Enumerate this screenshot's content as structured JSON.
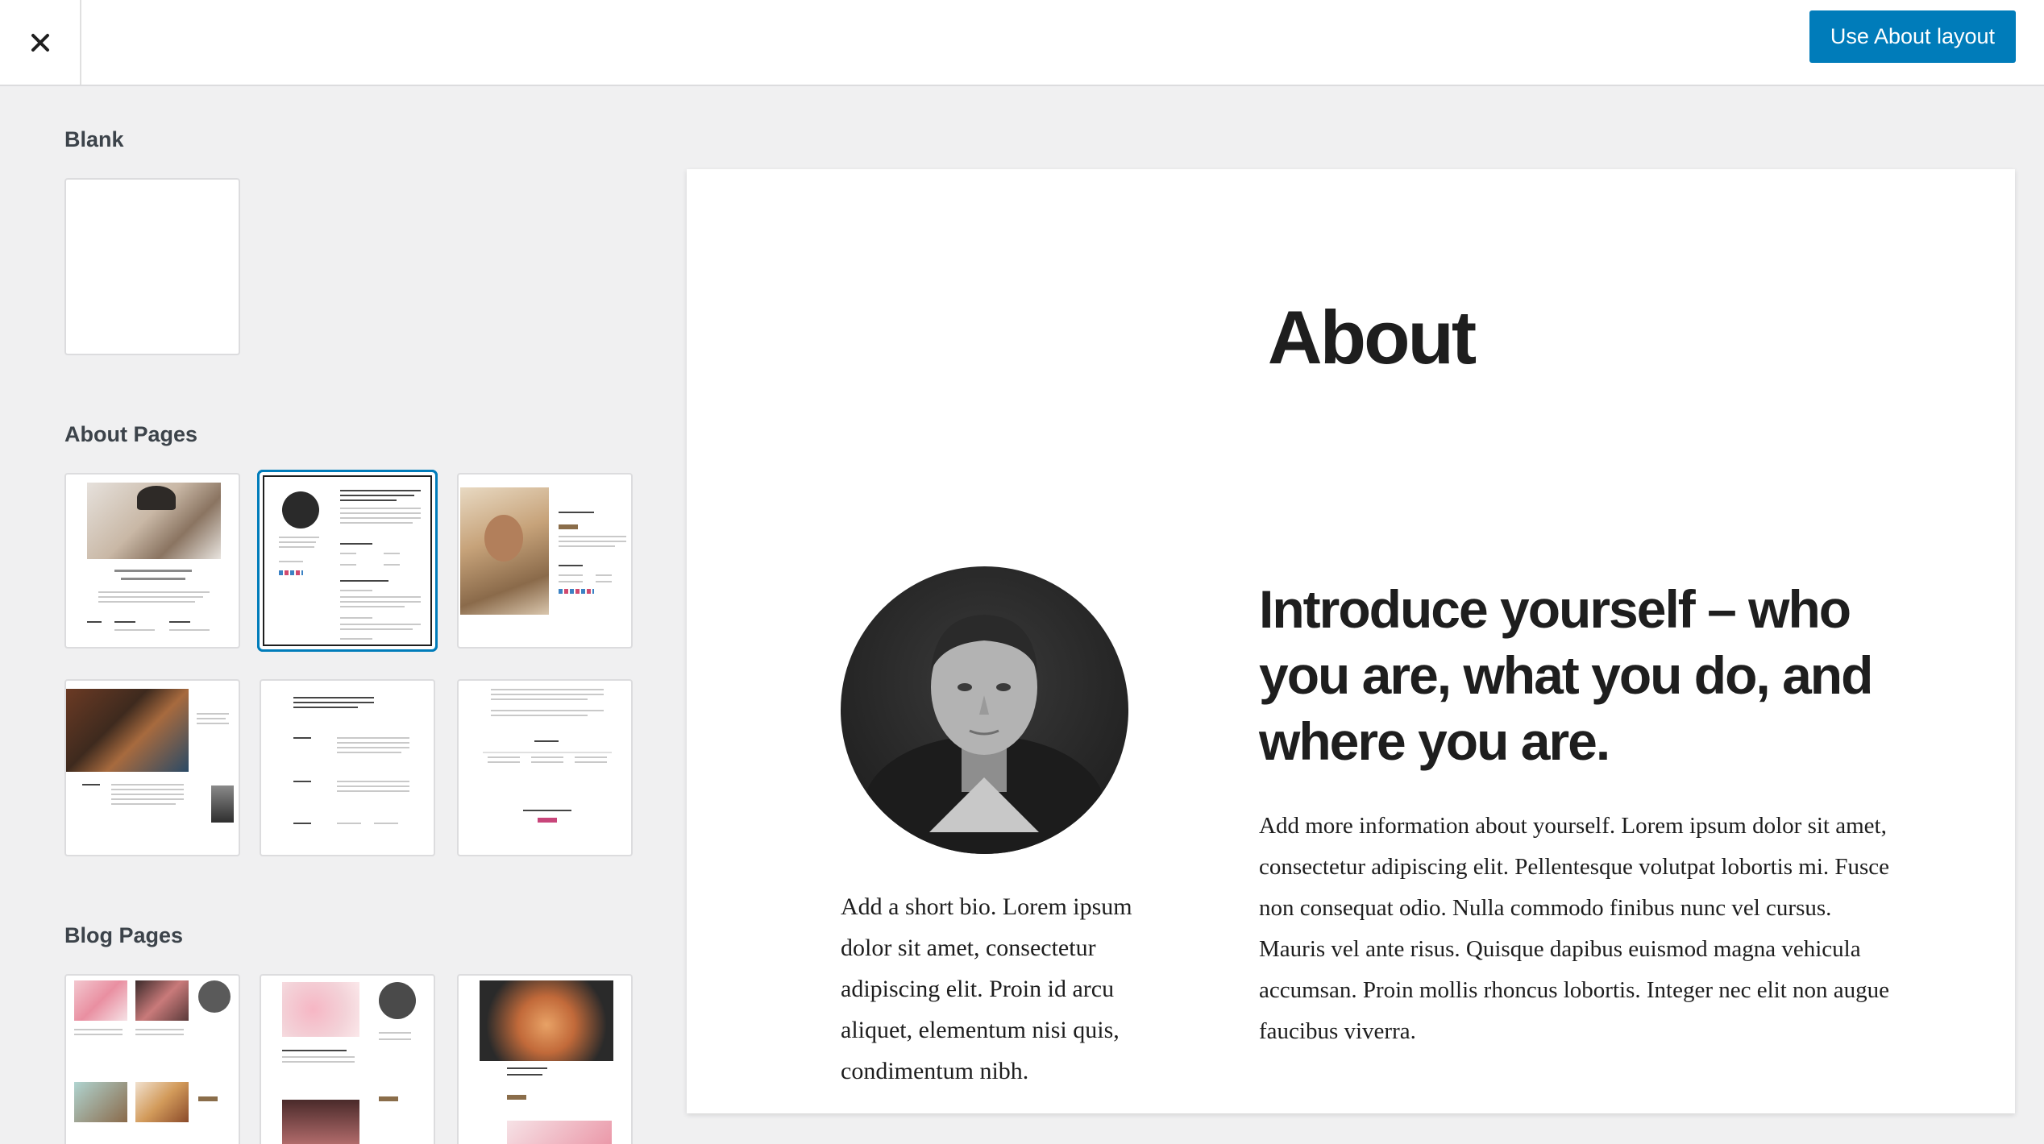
{
  "header": {
    "close_label": "×",
    "primary_button": "Use About layout"
  },
  "sidebar": {
    "sections": [
      {
        "title": "Blank"
      },
      {
        "title": "About Pages"
      },
      {
        "title": "Blog Pages"
      }
    ]
  },
  "preview": {
    "title": "About",
    "intro": "Introduce yourself – who you are, what you do, and where you are.",
    "bio": "Add a short bio. Lorem ipsum dolor sit amet, consectetur adipiscing elit. Proin id arcu aliquet, elementum nisi quis, condimentum nibh.",
    "more_info": "Add more information about yourself. Lorem ipsum dolor sit amet, consectetur adipiscing elit. Pellentesque volutpat lobortis mi. Fusce non consequat odio. Nulla commodo finibus nunc vel cursus. Mauris vel ante risus. Quisque dapibus euismod magna vehicula accumsan. Proin mollis rhoncus lobortis. Integer nec elit non augue faucibus viverra."
  },
  "colors": {
    "accent": "#007cba",
    "background": "#f0f0f1"
  }
}
